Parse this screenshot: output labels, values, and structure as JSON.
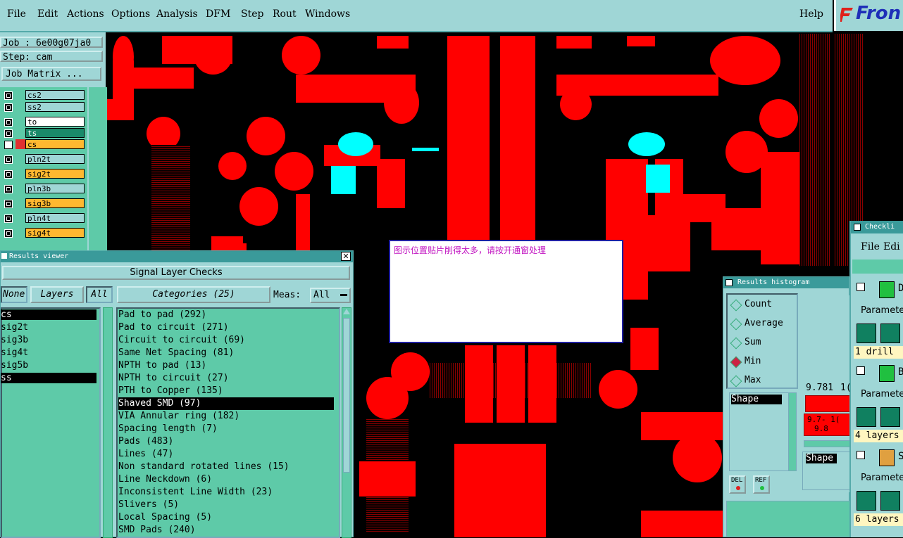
{
  "menubar": {
    "items": [
      "File",
      "Edit",
      "Actions",
      "Options",
      "Analysis",
      "DFM",
      "Step",
      "Rout",
      "Windows"
    ],
    "help": "Help",
    "logo": "Fron"
  },
  "job": {
    "job_label": "Job : 6e00g07ja0",
    "step_label": "Step: cam",
    "matrix_button": "Job Matrix ..."
  },
  "layers": [
    "cs2",
    "ss2",
    "to",
    "ts",
    "cs",
    "pln2t",
    "sig2t",
    "pln3b",
    "sig3b",
    "pln4t",
    "sig4t"
  ],
  "popup": {
    "message": "图示位置贴片削得太多，请按开通窗处理"
  },
  "results_viewer": {
    "title": "Results viewer",
    "header": "Signal Layer Checks",
    "none_button": "None",
    "layers_button": "Layers",
    "all_button": "All",
    "categories_button": "Categories (25)",
    "meas_label": "Meas:",
    "meas_value": "All",
    "layer_items": [
      "cs",
      "sig2t",
      "sig3b",
      "sig4t",
      "sig5b",
      "ss"
    ],
    "categories": [
      "Pad to pad (292)",
      "Pad to circuit (271)",
      "Circuit to circuit (69)",
      "Same Net Spacing (81)",
      "NPTH to pad (13)",
      "NPTH to circuit (27)",
      "PTH to Copper (135)",
      "Shaved SMD (97)",
      "VIA Annular ring (182)",
      "Spacing length (7)",
      "Pads (483)",
      "Lines (47)",
      "Non standard rotated lines (15)",
      "Line Neckdown (6)",
      "Inconsistent Line Width (23)",
      "Slivers (5)",
      "Local Spacing (5)",
      "SMD Pads (240)"
    ]
  },
  "histogram": {
    "title": "Results histogram",
    "options": [
      "Count",
      "Average",
      "Sum",
      "Min",
      "Max"
    ],
    "selected": "Min",
    "shape_label": "Shape",
    "shape_label2": "Shape",
    "value1": "9.781",
    "value1_cut": "1(",
    "range_a": "9.7- 1(",
    "range_b": "9.8",
    "del_button": "DEL",
    "ref_button": "REF"
  },
  "checklist": {
    "title": "Checkli",
    "file_menu": "File",
    "edit_menu": "Edi",
    "params": [
      "Paramete",
      "Paramete",
      "Paramete"
    ],
    "rows": [
      "1 drill",
      "4 layers",
      "6 layers"
    ],
    "item_letters": [
      "D",
      "B",
      "S"
    ]
  },
  "colors": {
    "copper": "#ff0000",
    "panel": "#9fd6d6",
    "list": "#5ecaa8",
    "highlight": "#00ffff"
  }
}
